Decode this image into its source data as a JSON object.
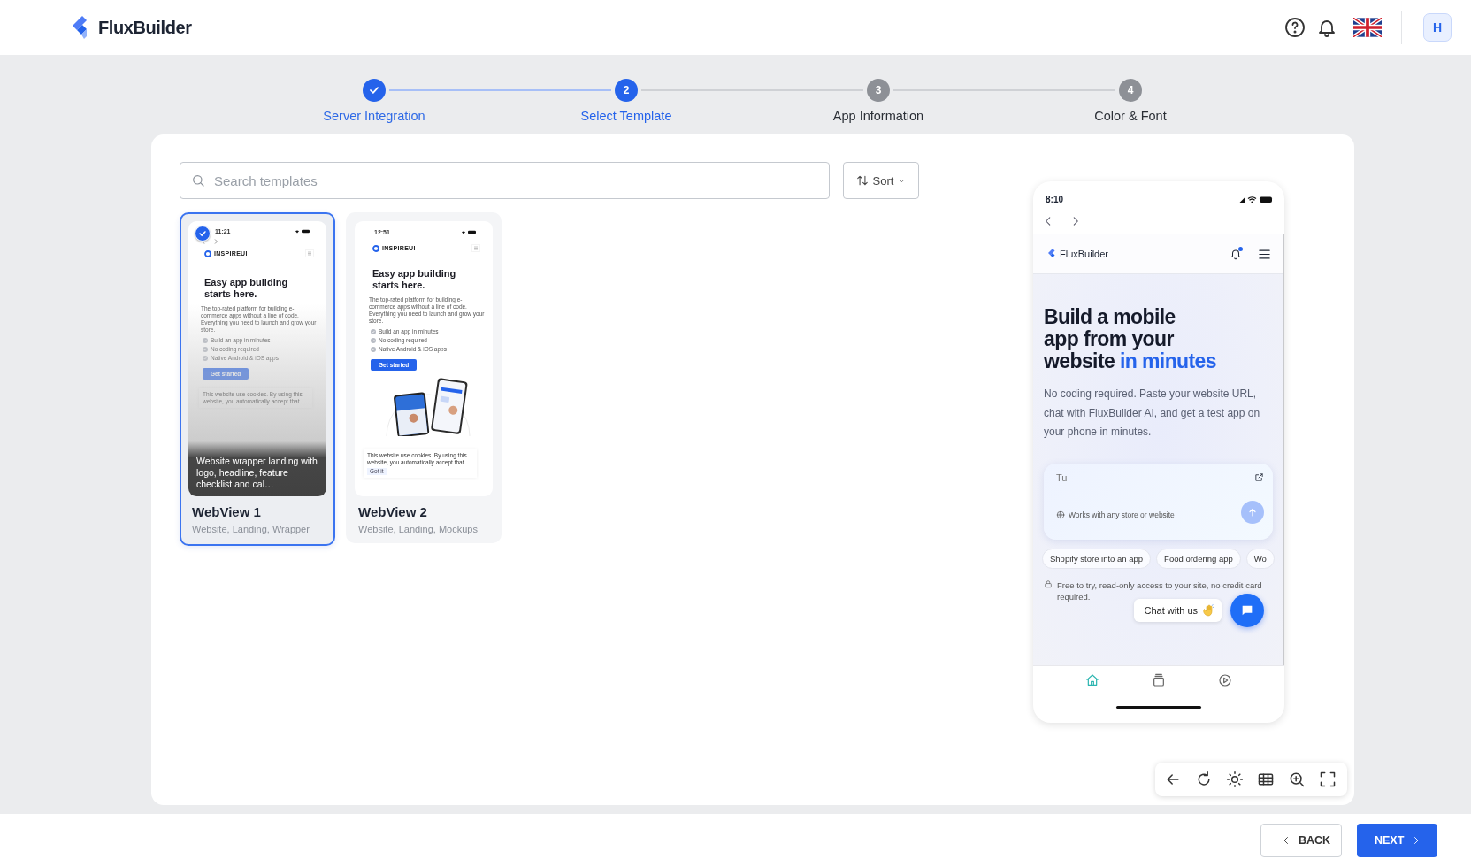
{
  "header": {
    "brand": "FluxBuilder",
    "avatar": "H"
  },
  "steps": [
    {
      "kind": "done",
      "label": "Server Integration",
      "completed": true
    },
    {
      "kind": "current",
      "label": "Select Template",
      "number": "2",
      "completed": false
    },
    {
      "kind": "upcoming",
      "label": "App Information",
      "number": "3",
      "completed": false
    },
    {
      "kind": "upcoming",
      "label": "Color & Font",
      "number": "4",
      "completed": false
    }
  ],
  "search": {
    "placeholder": "Search templates"
  },
  "sort": {
    "label": "Sort"
  },
  "templates": [
    {
      "title": "WebView 1",
      "tags": "Website, Landing, Wrapper",
      "selected": true,
      "description": "Website wrapper landing with logo, headline, feature checklist and cal…",
      "preview": {
        "time": "11:21",
        "browser_nav": true,
        "brand": "INSPIREUI",
        "headline": "Easy app building starts here.",
        "body": "The top-rated platform for building e-commerce apps without a line of code. Everything you need to launch and grow your store.",
        "checklist": [
          "Build an app in minutes",
          "No coding required",
          "Native Android & iOS apps"
        ],
        "cta": "Get started",
        "cookie": "This website use cookies. By using this website, you automatically accept that."
      }
    },
    {
      "title": "WebView 2",
      "tags": "Website, Landing, Mockups",
      "selected": false,
      "preview": {
        "time": "12:51",
        "browser_nav": false,
        "brand": "INSPIREUI",
        "headline": "Easy app building starts here.",
        "body": "The top-rated platform for building e-commerce apps without a line of code. Everything you need to launch and grow your store.",
        "checklist": [
          "Build an app in minutes",
          "No coding required",
          "Native Android & iOS apps"
        ],
        "cta": "Get started",
        "image": {
          "kind": "picture"
        },
        "cookie": "This website use cookies. By using this website, you automatically accept that.",
        "cookie_button": "Got it"
      }
    }
  ],
  "phone": {
    "time": "8:10",
    "brand": "FluxBuilder",
    "headline": [
      "Build a mobile",
      "app from your",
      "website"
    ],
    "headline_accent": "in minutes",
    "body": "No coding required. Paste your website URL, chat with FluxBuilder AI, and get a test app on your phone in minutes.",
    "input": {
      "placeholder": "Tu",
      "hint": "Works with any store or website"
    },
    "chips": [
      "Shopify store into an app",
      "Food ordering app",
      "Wo"
    ],
    "note": "Free to try, read-only access to your site, no credit card required.",
    "chat": "Chat with us",
    "tabs": [
      {
        "kind": "home",
        "selected": true
      },
      {
        "kind": "stack",
        "selected": false
      },
      {
        "kind": "play",
        "selected": false
      }
    ]
  },
  "tools": [
    {
      "kind": "back"
    },
    {
      "kind": "refresh"
    },
    {
      "kind": "brightness"
    },
    {
      "kind": "grid"
    },
    {
      "kind": "zoom"
    },
    {
      "kind": "fullscreen"
    }
  ],
  "footer": {
    "back": "BACK",
    "next": "NEXT"
  }
}
